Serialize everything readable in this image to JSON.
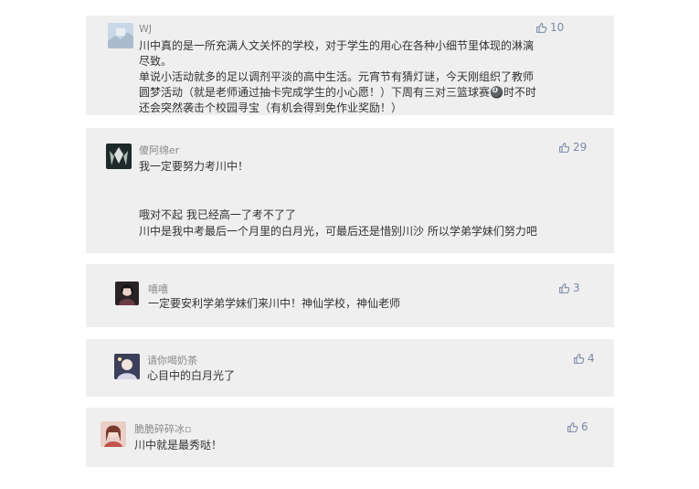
{
  "comments": [
    {
      "user": "WJ",
      "likes": "10",
      "lines": [
        "川中真的是一所充满人文关怀的学校，对于学生的用心在各种小细节里体现的淋漓",
        "尽致。",
        "单说小活动就多的足以调剂平淡的高中生活。元宵节有猜灯谜，今天刚组织了教师",
        "圆梦活动（就是老师通过抽卡完成学生的小心愿！）下周有三对三篮球赛🎱时不时",
        "还会突然袭击个校园寻宝（有机会得到免作业奖励！）"
      ]
    },
    {
      "user": "傻阿绵er",
      "likes": "29",
      "lines": [
        "我一定要努力考川中！",
        "哦对不起 我已经高一了考不了了",
        "川中是我中考最后一个月里的白月光，可最后还是惜别川沙 所以学弟学妹们努力吧"
      ]
    },
    {
      "user": "嘻嘻",
      "likes": "3",
      "lines": [
        "一定要安利学弟学妹们来川中！神仙学校，神仙老师"
      ]
    },
    {
      "user": "请你喝奶茶",
      "likes": "4",
      "lines": [
        "心目中的白月光了"
      ]
    },
    {
      "user": "脆脆碎碎冰▫",
      "likes": "6",
      "lines": [
        "川中就是最秀哒！"
      ]
    }
  ],
  "icons": {
    "like": "thumbs-up-icon"
  },
  "colors": {
    "card_bg": "#efeff0",
    "like": "#7b8aa6",
    "username": "#8a8a8a",
    "text": "#333333"
  }
}
